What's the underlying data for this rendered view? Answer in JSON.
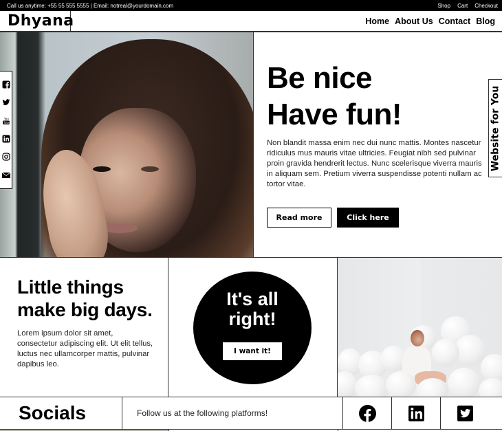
{
  "topbar": {
    "contact": "Call us anytime: +55 55 555 5555 | Email: notreal@yourdomain.com",
    "links": [
      "Shop",
      "Cart",
      "Checkout"
    ]
  },
  "header": {
    "logo": "Dhyana",
    "nav": [
      "Home",
      "About Us",
      "Contact",
      "Blog"
    ]
  },
  "side_rail": {
    "icons": [
      "facebook-icon",
      "twitter-icon",
      "youtube-icon",
      "linkedin-icon",
      "instagram-icon",
      "email-icon"
    ]
  },
  "vertical_tab": {
    "label": "Website for You"
  },
  "hero": {
    "title_line1": "Be nice",
    "title_line2": "Have fun!",
    "body": "Non blandit massa enim nec dui nunc mattis. Montes nascetur ridiculus mus mauris vitae ultricies. Feugiat nibh sed pulvinar proin gravida hendrerit lectus. Nunc scelerisque viverra mauris in aliquam sem. Pretium viverra suspendisse potenti nullam ac tortor vitae.",
    "read_more_label": "Read more",
    "click_here_label": "Click here"
  },
  "middle": {
    "heading_line1": "Little things",
    "heading_line2": "make big days.",
    "body": "Lorem ipsum dolor sit amet, consectetur adipiscing elit. Ut elit tellus, luctus nec ullamcorper mattis, pulvinar dapibus leo.",
    "circle_line1": "It's all",
    "circle_line2": "right!",
    "cta_label": "I want it!"
  },
  "socials": {
    "title": "Socials",
    "text": "Follow us at the following platforms!",
    "icons": [
      "facebook-icon",
      "linkedin-icon",
      "twitter-icon"
    ]
  }
}
